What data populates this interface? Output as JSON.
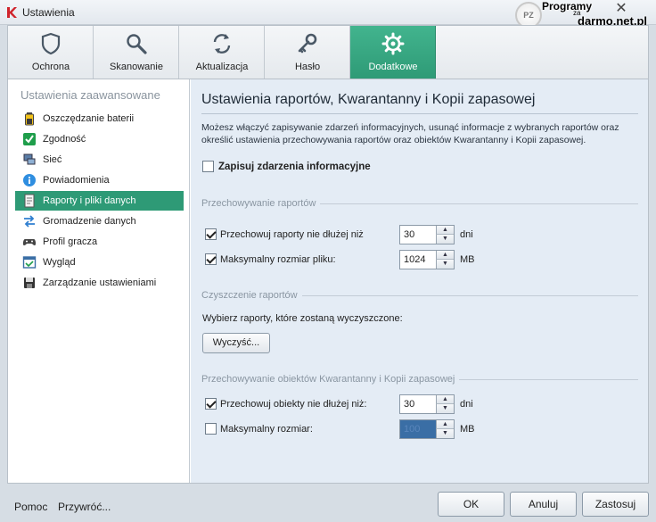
{
  "window": {
    "title": "Ustawienia",
    "close_symbol": "✕"
  },
  "watermark": {
    "line1": "Programy",
    "line2": "za",
    "line3": "darmo.net.pl",
    "logo_text": "PZ"
  },
  "tabs": [
    {
      "label": "Ochrona",
      "icon": "shield-icon"
    },
    {
      "label": "Skanowanie",
      "icon": "magnifier-icon"
    },
    {
      "label": "Aktualizacja",
      "icon": "refresh-icon"
    },
    {
      "label": "Hasło",
      "icon": "key-icon"
    },
    {
      "label": "Dodatkowe",
      "icon": "gear-icon",
      "active": true
    }
  ],
  "sidebar": {
    "heading": "Ustawienia zaawansowane",
    "items": [
      {
        "label": "Oszczędzanie baterii",
        "icon": "battery-icon"
      },
      {
        "label": "Zgodność",
        "icon": "checkmark-icon"
      },
      {
        "label": "Sieć",
        "icon": "network-icon"
      },
      {
        "label": "Powiadomienia",
        "icon": "info-icon"
      },
      {
        "label": "Raporty i pliki danych",
        "icon": "reports-icon",
        "active": true
      },
      {
        "label": "Gromadzenie danych",
        "icon": "exchange-arrows-icon"
      },
      {
        "label": "Profil gracza",
        "icon": "gamepad-icon"
      },
      {
        "label": "Wygląd",
        "icon": "appearance-icon"
      },
      {
        "label": "Zarządzanie ustawieniami",
        "icon": "save-disk-icon"
      }
    ]
  },
  "content": {
    "title": "Ustawienia raportów, Kwarantanny i Kopii zapasowej",
    "description": "Możesz włączyć zapisywanie zdarzeń informacyjnych, usunąć informacje z wybranych raportów oraz określić ustawienia przechowywania raportów oraz obiektów Kwarantanny i Kopii zapasowej.",
    "log_informational": {
      "label": "Zapisuj zdarzenia informacyjne",
      "checked": false
    },
    "reports_section": {
      "title": "Przechowywanie raportów",
      "keep_days": {
        "label": "Przechowuj raporty nie dłużej niż",
        "checked": true,
        "value": "30",
        "unit": "dni"
      },
      "max_size": {
        "label": "Maksymalny rozmiar pliku:",
        "checked": true,
        "value": "1024",
        "unit": "MB"
      }
    },
    "clear_section": {
      "title": "Czyszczenie raportów",
      "prompt": "Wybierz raporty, które zostaną wyczyszczone:",
      "clear_button": "Wyczyść..."
    },
    "quarantine_section": {
      "title": "Przechowywanie obiektów Kwarantanny i Kopii zapasowej",
      "keep_days": {
        "label": "Przechowuj obiekty nie dłużej niż:",
        "checked": true,
        "value": "30",
        "unit": "dni"
      },
      "max_size": {
        "label": "Maksymalny rozmiar:",
        "checked": false,
        "value": "100",
        "unit": "MB"
      }
    }
  },
  "footer": {
    "help": "Pomoc",
    "restore": "Przywróć...",
    "ok": "OK",
    "cancel": "Anuluj",
    "apply": "Zastosuj"
  },
  "colors": {
    "accent": "#2e9a76",
    "content_bg": "#e4ecf5",
    "window_bg": "#d6dde4"
  }
}
